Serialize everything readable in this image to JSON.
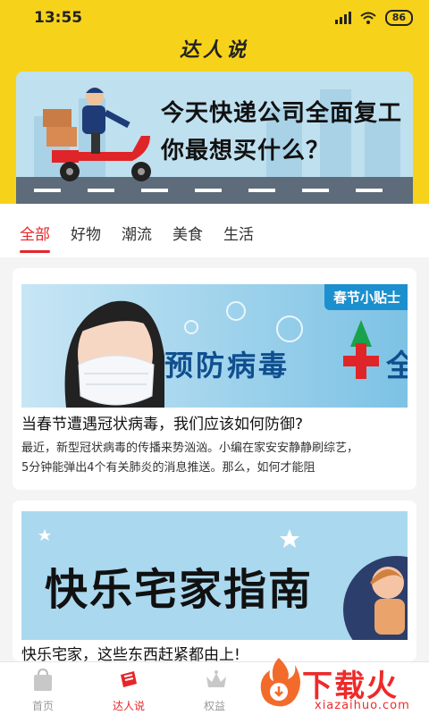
{
  "status": {
    "time": "13:55",
    "battery": "86"
  },
  "app": {
    "title": "达人说"
  },
  "banner": {
    "line1": "今天快递公司全面复工",
    "line2": "你最想买什么？"
  },
  "tabs": [
    {
      "label": "全部",
      "active": true
    },
    {
      "label": "好物"
    },
    {
      "label": "潮流"
    },
    {
      "label": "美食"
    },
    {
      "label": "生活"
    }
  ],
  "cards": [
    {
      "image_badge": "春节小贴士",
      "image_headline": "预防病毒",
      "image_trailing": "全",
      "title": "当春节遭遇冠状病毒，我们应该如何防御?",
      "desc_line1": "最近，新型冠状病毒的传播来势汹汹。小编在家安安静静刷综艺，",
      "desc_line2": "5分钟能弹出4个有关肺炎的消息推送。那么，如何才能阻"
    },
    {
      "image_headline": "快乐宅家指南",
      "title": "快乐宅家，这些东西赶紧都由上!"
    }
  ],
  "tabbar": [
    {
      "label": "首页",
      "icon": "bag-icon"
    },
    {
      "label": "达人说",
      "icon": "ticket-icon",
      "active": true
    },
    {
      "label": "权益",
      "icon": "crown-icon"
    }
  ],
  "watermark": {
    "text": "下载火",
    "url": "xiazaihuo.com"
  },
  "colors": {
    "header": "#f7d21a",
    "accent": "#e5262a"
  }
}
